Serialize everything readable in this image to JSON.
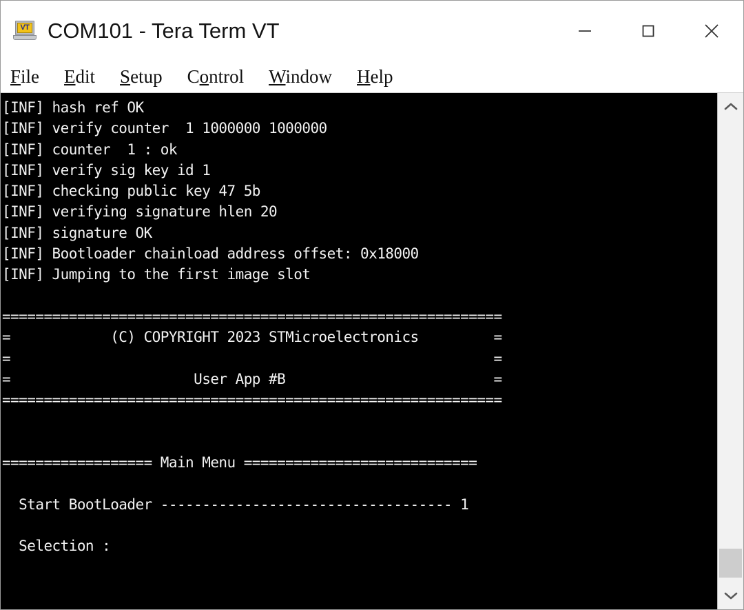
{
  "window": {
    "title": "COM101 - Tera Term VT",
    "icon": "teraterm-vt-laptop-icon",
    "icon_text": "VT",
    "controls": {
      "minimize": "minimize-icon",
      "maximize": "maximize-icon",
      "close": "close-icon"
    }
  },
  "menubar": {
    "items": [
      {
        "label": "File",
        "accel": "F"
      },
      {
        "label": "Edit",
        "accel": "E"
      },
      {
        "label": "Setup",
        "accel": "S"
      },
      {
        "label": "Control",
        "accel": "o"
      },
      {
        "label": "Window",
        "accel": "W"
      },
      {
        "label": "Help",
        "accel": "H"
      }
    ]
  },
  "terminal": {
    "background_color": "#000000",
    "foreground_color": "#f2f2f2",
    "lines": [
      "[INF] hash ref OK",
      "[INF] verify counter  1 1000000 1000000",
      "[INF] counter  1 : ok",
      "[INF] verify sig key id 1",
      "[INF] checking public key 47 5b",
      "[INF] verifying signature hlen 20",
      "[INF] signature OK",
      "[INF] Bootloader chainload address offset: 0x18000",
      "[INF] Jumping to the first image slot",
      "",
      "============================================================",
      "=            (C) COPYRIGHT 2023 STMicroelectronics         =",
      "=                                                          =",
      "=                      User App #B                         =",
      "============================================================",
      "",
      "",
      "================== Main Menu ============================",
      "",
      "  Start BootLoader ----------------------------------- 1",
      "",
      "  Selection :"
    ]
  },
  "scrollbar": {
    "up_arrow": "chevron-up-icon",
    "down_arrow": "chevron-down-icon",
    "thumb": "scrollbar-thumb"
  }
}
